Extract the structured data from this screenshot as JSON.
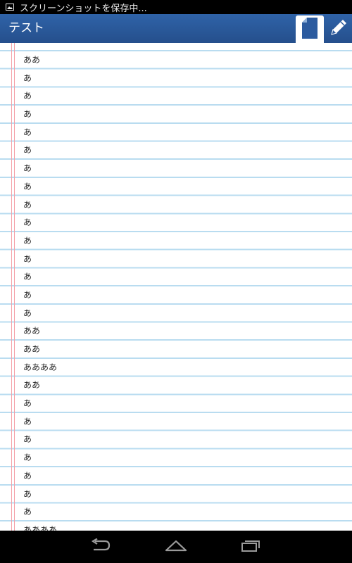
{
  "status_bar": {
    "notification_icon": "screenshot-image-icon",
    "text": "スクリーンショットを保存中..."
  },
  "app_bar": {
    "title": "テスト",
    "note_icon": "note-page-icon",
    "edit_icon": "pencil-icon"
  },
  "note": {
    "lines": [
      "ああ",
      "あ",
      "あ",
      "あ",
      "あ",
      "あ",
      "あ",
      "あ",
      "あ",
      "あ",
      "あ",
      "あ",
      "あ",
      "あ",
      "あ",
      "ああ",
      "ああ",
      "ああああ",
      "ああ",
      "あ",
      "あ",
      "あ",
      "あ",
      "あ",
      "あ",
      "あ",
      "ああああ"
    ]
  },
  "nav_bar": {
    "back_icon": "back-arrow-icon",
    "home_icon": "home-icon",
    "recents_icon": "recent-apps-icon"
  },
  "colors": {
    "app_bar": "#2c5b9f",
    "margin_line": "#f4a0a8",
    "rule_line": "#b9dcf0"
  }
}
